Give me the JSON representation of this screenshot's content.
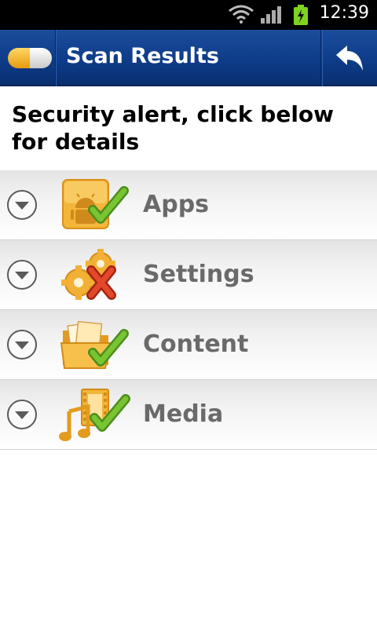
{
  "status_bar": {
    "time": "12:39",
    "icons": [
      "wifi-icon",
      "signal-icon",
      "battery-charging-icon"
    ]
  },
  "header": {
    "title": "Scan Results",
    "logo_icon": "pill-logo-icon",
    "back_icon": "back-arrow-icon"
  },
  "alert": {
    "text": "Security alert, click below for details"
  },
  "categories": [
    {
      "label": "Apps",
      "icon": "android-check-icon",
      "status": "ok"
    },
    {
      "label": "Settings",
      "icon": "gears-x-icon",
      "status": "alert"
    },
    {
      "label": "Content",
      "icon": "folder-check-icon",
      "status": "ok"
    },
    {
      "label": "Media",
      "icon": "media-check-icon",
      "status": "ok"
    }
  ],
  "colors": {
    "header": "#0e3c89",
    "accent_orange": "#f1a91c",
    "check_green": "#6ab92c",
    "alert_red": "#d6341a",
    "label_gray": "#6a6a6a"
  }
}
